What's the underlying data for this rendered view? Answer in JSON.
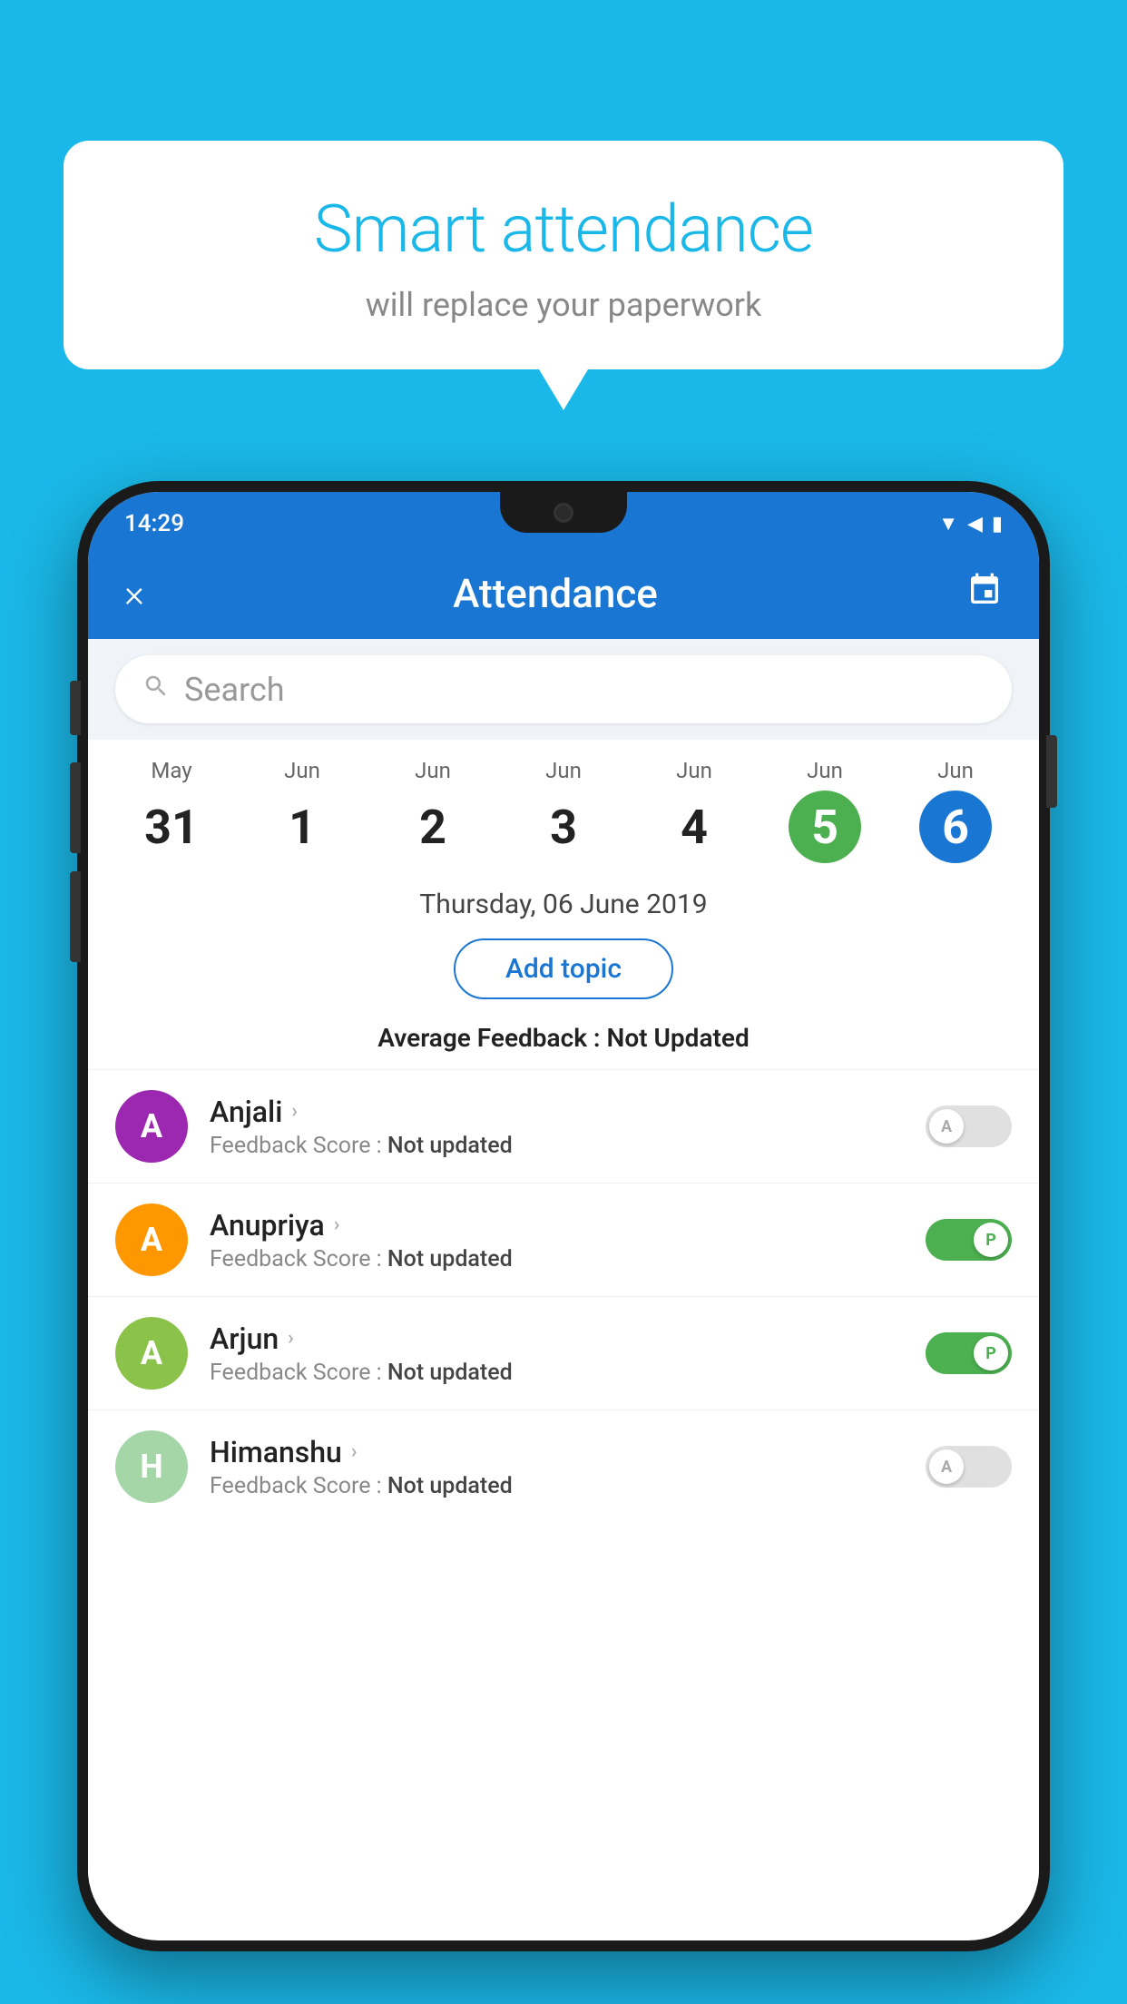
{
  "background_color": "#1ab8e8",
  "bubble": {
    "title": "Smart attendance",
    "subtitle": "will replace your paperwork"
  },
  "phone": {
    "status_bar": {
      "time": "14:29"
    },
    "header": {
      "title": "Attendance",
      "close_label": "×",
      "calendar_icon": "calendar-icon"
    },
    "search": {
      "placeholder": "Search"
    },
    "calendar": {
      "days": [
        {
          "month": "May",
          "num": "31",
          "state": "normal"
        },
        {
          "month": "Jun",
          "num": "1",
          "state": "normal"
        },
        {
          "month": "Jun",
          "num": "2",
          "state": "normal"
        },
        {
          "month": "Jun",
          "num": "3",
          "state": "normal"
        },
        {
          "month": "Jun",
          "num": "4",
          "state": "normal"
        },
        {
          "month": "Jun",
          "num": "5",
          "state": "today"
        },
        {
          "month": "Jun",
          "num": "6",
          "state": "selected"
        }
      ]
    },
    "selected_date": "Thursday, 06 June 2019",
    "add_topic_label": "Add topic",
    "avg_feedback_label": "Average Feedback :",
    "avg_feedback_value": "Not Updated",
    "students": [
      {
        "name": "Anjali",
        "avatar_letter": "A",
        "avatar_color": "#9c27b0",
        "feedback_label": "Feedback Score :",
        "feedback_value": "Not updated",
        "toggle_state": "off",
        "toggle_label": "A"
      },
      {
        "name": "Anupriya",
        "avatar_letter": "A",
        "avatar_color": "#ff9800",
        "feedback_label": "Feedback Score :",
        "feedback_value": "Not updated",
        "toggle_state": "on",
        "toggle_label": "P"
      },
      {
        "name": "Arjun",
        "avatar_letter": "A",
        "avatar_color": "#8bc34a",
        "feedback_label": "Feedback Score :",
        "feedback_value": "Not updated",
        "toggle_state": "on",
        "toggle_label": "P"
      },
      {
        "name": "Himanshu",
        "avatar_letter": "H",
        "avatar_color": "#a5d6a7",
        "feedback_label": "Feedback Score :",
        "feedback_value": "Not updated",
        "toggle_state": "off",
        "toggle_label": "A"
      }
    ]
  }
}
